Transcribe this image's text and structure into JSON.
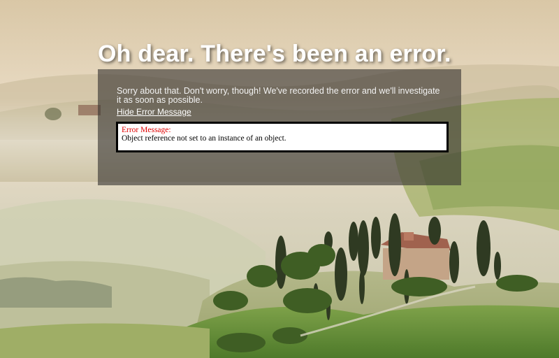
{
  "heading": "Oh dear. There's been an error.",
  "message": "Sorry about that. Don't worry, though! We've recorded the error and we'll investigate it as soon as possible.",
  "hide_link": "Hide Error Message",
  "error": {
    "label": "Error Message:",
    "text": "Object reference not set to an instance of an object."
  },
  "colors": {
    "panel": "#37342f",
    "error_label": "#e00000",
    "heading": "#ffffff"
  }
}
